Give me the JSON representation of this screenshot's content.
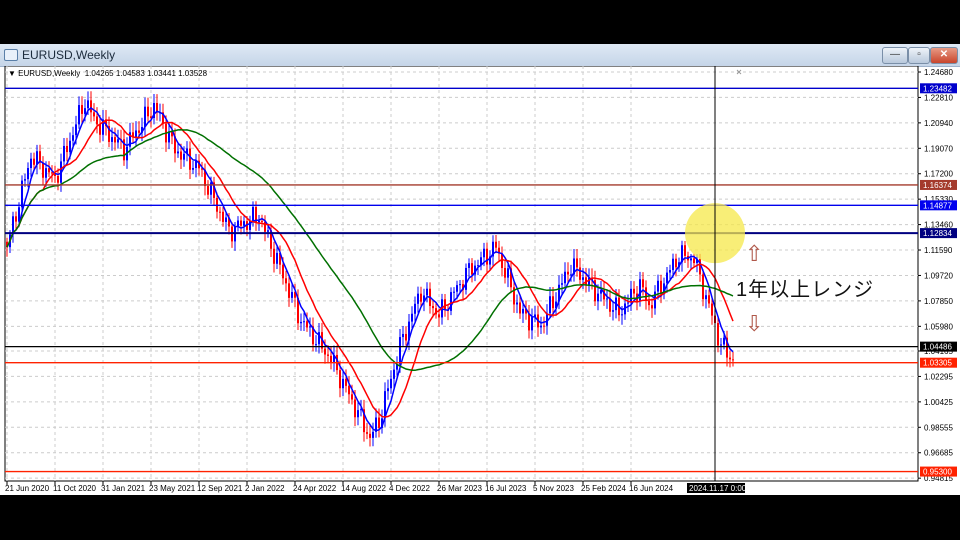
{
  "window": {
    "title": "EURUSD,Weekly",
    "minimize": "—",
    "restore": "▫",
    "close": "✕"
  },
  "info_bar": {
    "symbol": "EURUSD,Weekly",
    "ohlc": "1.04265 1.04583 1.03441 1.03528"
  },
  "annotation": {
    "text": "1年以上レンジ",
    "up_arrow": "⇧",
    "down_arrow": "⇩"
  },
  "chart_data": {
    "type": "candlestick",
    "symbol": "EURUSD",
    "timeframe": "Weekly",
    "ylim": [
      0.94815,
      1.2468
    ],
    "y_ticks": [
      "1.24680",
      "1.22810",
      "1.20940",
      "1.19070",
      "1.17200",
      "1.15330",
      "1.13460",
      "1.11590",
      "1.09720",
      "1.07850",
      "1.05980",
      "1.04165",
      "1.02295",
      "1.00425",
      "0.98555",
      "0.96685",
      "0.94815"
    ],
    "x_ticks": [
      "21 Jun 2020",
      "11 Oct 2020",
      "31 Jan 2021",
      "23 May 2021",
      "12 Sep 2021",
      "2 Jan 2022",
      "24 Apr 2022",
      "14 Aug 2022",
      "4 Dec 2022",
      "26 Mar 2023",
      "16 Jul 2023",
      "5 Nov 2023",
      "25 Feb 2024",
      "16 Jun 2024"
    ],
    "crosshair_label": "2024.11.17 0:00",
    "price_path_keypoints": [
      [
        0,
        1.118
      ],
      [
        8,
        1.185
      ],
      [
        16,
        1.168
      ],
      [
        26,
        1.226
      ],
      [
        29,
        1.212
      ],
      [
        39,
        1.19
      ],
      [
        49,
        1.222
      ],
      [
        56,
        1.19
      ],
      [
        64,
        1.176
      ],
      [
        74,
        1.13
      ],
      [
        84,
        1.141
      ],
      [
        98,
        1.064
      ],
      [
        108,
        1.036
      ],
      [
        121,
        0.978
      ],
      [
        124,
        0.99
      ],
      [
        131,
        1.045
      ],
      [
        138,
        1.086
      ],
      [
        144,
        1.068
      ],
      [
        154,
        1.101
      ],
      [
        163,
        1.118
      ],
      [
        171,
        1.07
      ],
      [
        178,
        1.06
      ],
      [
        188,
        1.105
      ],
      [
        198,
        1.082
      ],
      [
        204,
        1.07
      ],
      [
        211,
        1.09
      ],
      [
        214,
        1.075
      ],
      [
        224,
        1.112
      ],
      [
        229,
        1.11
      ],
      [
        233,
        1.081
      ],
      [
        238,
        1.046
      ],
      [
        242,
        1.035
      ]
    ],
    "moving_averages": [
      {
        "period": 5,
        "color": "#0000ff"
      },
      {
        "period": 13,
        "color": "#ff0000"
      },
      {
        "period": 40,
        "color": "#007000"
      }
    ],
    "horizontal_lines": [
      {
        "price": 1.23482,
        "label": "1.23482",
        "color": "#0000cc"
      },
      {
        "price": 1.16374,
        "label": "1.16374",
        "color": "#a43a2c"
      },
      {
        "price": 1.14877,
        "label": "1.14877",
        "color": "#0000ee"
      },
      {
        "price": 1.12834,
        "label": "1.12834",
        "color": "#000080"
      },
      {
        "price": 1.04486,
        "label": "1.04486",
        "color": "#000000"
      },
      {
        "price": 1.03305,
        "label": "1.03305",
        "color": "#ff2200"
      },
      {
        "price": 0.953,
        "label": "0.95300",
        "color": "#ff2200"
      }
    ],
    "crosshair_price": 1.12834,
    "highlight_color": "#f5e84a"
  }
}
